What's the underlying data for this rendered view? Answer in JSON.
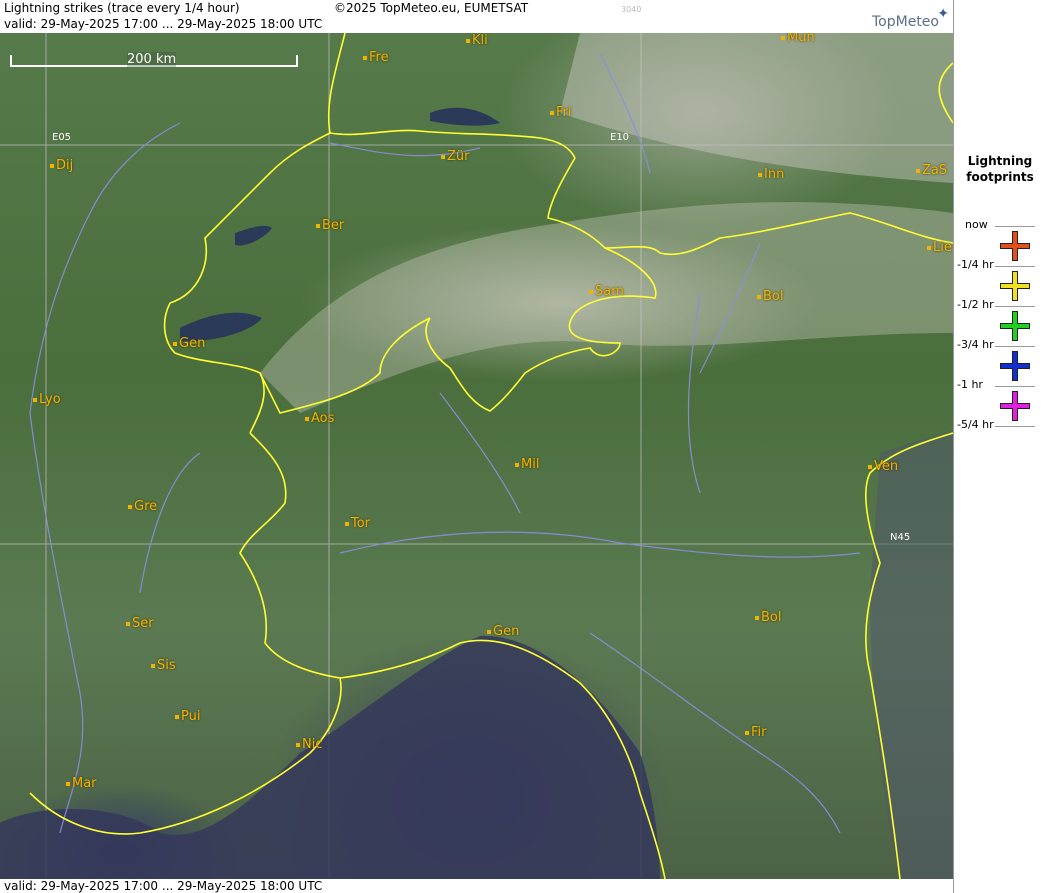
{
  "header": {
    "title": "Lightning strikes (trace every 1/4 hour)",
    "copyright": "©2025 TopMeteo.eu, EUMETSAT",
    "code": "3040",
    "valid": "valid:  29-May-2025 17:00 ... 29-May-2025 18:00 UTC",
    "brand": "TopMeteo"
  },
  "footer": {
    "valid": "valid:  29-May-2025 17:00 ... 29-May-2025 18:00 UTC"
  },
  "map": {
    "scale_label": "200 km",
    "grid_labels": {
      "e05": "E05",
      "e10": "E10",
      "n45": "N45"
    },
    "cities": {
      "kli": "Kli",
      "mun": "Mun",
      "fre": "Fre",
      "fri": "Fri",
      "zur": "Zür",
      "dij": "Dij",
      "inn": "Inn",
      "zas": "ZaS",
      "ber": "Ber",
      "lie": "Lie",
      "sam": "Sam",
      "bol_n": "Bol",
      "gen_ch": "Gen",
      "lyo": "Lyo",
      "aos": "Aos",
      "mil": "Mil",
      "ven": "Ven",
      "gre": "Gre",
      "tor": "Tor",
      "ser": "Ser",
      "gen_it": "Gen",
      "bol_s": "Bol",
      "sis": "Sis",
      "pui": "Pui",
      "nic": "Nic",
      "fir": "Fir",
      "mar": "Mar"
    },
    "colors": {
      "border": "#ffff33",
      "river": "#8a8fe0",
      "grid": "#b8b8b8",
      "city": "#f0b400"
    }
  },
  "legend": {
    "title_line1": "Lightning",
    "title_line2": "footprints",
    "rows": [
      {
        "label_top": "now",
        "label_bottom": "-1/4 hr",
        "color": "#e0501a"
      },
      {
        "label_bottom": "-1/2 hr",
        "color": "#f0e020"
      },
      {
        "label_bottom": "-3/4 hr",
        "color": "#20d020"
      },
      {
        "label_bottom": "-1 hr",
        "color": "#1030d0"
      },
      {
        "label_bottom": "-5/4 hr",
        "color": "#e020e0"
      }
    ]
  }
}
